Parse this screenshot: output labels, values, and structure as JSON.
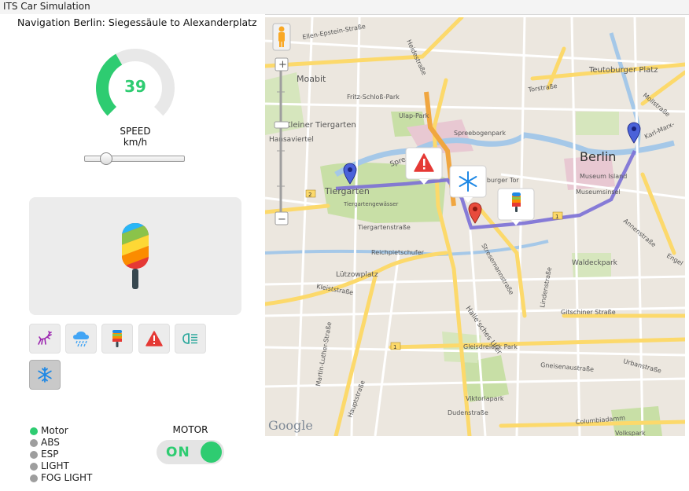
{
  "window": {
    "title": "ITS Car Simulation"
  },
  "panel": {
    "nav_title": "Navigation Berlin: Siegessäule to Alexanderplatz",
    "speed": {
      "value": "39",
      "label": "SPEED",
      "unit": "km/h",
      "gauge_fraction": 0.39,
      "slider_fraction": 0.18
    },
    "preview_icon": "popsicle-icon",
    "buttons": [
      {
        "icon": "deer-icon"
      },
      {
        "icon": "rain-cloud-icon"
      },
      {
        "icon": "popsicle-icon"
      },
      {
        "icon": "warning-icon"
      },
      {
        "icon": "fog-light-icon"
      },
      {
        "icon": "snowflake-icon",
        "active": true
      }
    ],
    "status": [
      {
        "label": "Motor",
        "on": true
      },
      {
        "label": "ABS",
        "on": false
      },
      {
        "label": "ESP",
        "on": false
      },
      {
        "label": "LIGHT",
        "on": false
      },
      {
        "label": "FOG LIGHT",
        "on": false
      }
    ],
    "motor": {
      "label": "MOTOR",
      "state": "ON"
    }
  },
  "colors": {
    "accent": "#2ecc71",
    "route": "#7b6fd6",
    "warning": "#e53935",
    "snow": "#1e88e5"
  },
  "map": {
    "city": "Berlin",
    "district_labels": [
      "Moabit",
      "Kleiner Tiergarten",
      "Hansaviertel",
      "Tiergarten",
      "Teutoburger Platz",
      "Museum Island",
      "Lützowplatz",
      "Halle'sches Ufer",
      "Waldeckpark",
      "Gleisdreieck Park",
      "Viktoriapark",
      "Volkspark"
    ],
    "street_labels": [
      "Ellen-Epstein-Straße",
      "Heidestraße",
      "Fritz-Schloß-Park",
      "Ulap-Park",
      "Spreebogenpark",
      "Torstraße",
      "Mollstraße",
      "Karl-Marx-",
      "Tiergartenstraße",
      "Reichpietschufer",
      "Kleiststraße",
      "Gitschiner Straße",
      "Gneisenaustraße",
      "Urbanstraße",
      "Dudenstraße",
      "Hauptstraße",
      "Columbiadamm",
      "Martin-Luther-Straße",
      "Stresemannstraße",
      "Lindenstraße",
      "Annenstraße",
      "Museumsinsel",
      "Tiergartengewässer",
      "Brandenburger Tor",
      "Spree",
      "Engel"
    ],
    "attribution": "Google",
    "zoom_controls": {
      "in": "+",
      "out": "−"
    }
  }
}
